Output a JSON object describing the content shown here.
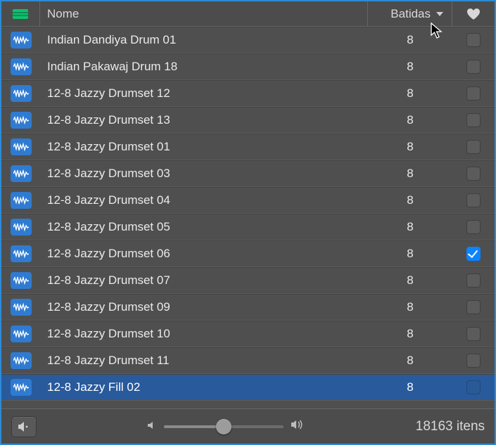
{
  "header": {
    "name_label": "Nome",
    "beats_label": "Batidas",
    "sort_direction": "desc"
  },
  "rows": [
    {
      "name": "Indian Dandiya Drum 01",
      "beats": "8",
      "favorite": false,
      "selected": false
    },
    {
      "name": "Indian Pakawaj Drum 18",
      "beats": "8",
      "favorite": false,
      "selected": false
    },
    {
      "name": "12-8 Jazzy Drumset 12",
      "beats": "8",
      "favorite": false,
      "selected": false
    },
    {
      "name": "12-8 Jazzy Drumset 13",
      "beats": "8",
      "favorite": false,
      "selected": false
    },
    {
      "name": "12-8 Jazzy Drumset 01",
      "beats": "8",
      "favorite": false,
      "selected": false
    },
    {
      "name": "12-8 Jazzy Drumset 03",
      "beats": "8",
      "favorite": false,
      "selected": false
    },
    {
      "name": "12-8 Jazzy Drumset 04",
      "beats": "8",
      "favorite": false,
      "selected": false
    },
    {
      "name": "12-8 Jazzy Drumset 05",
      "beats": "8",
      "favorite": false,
      "selected": false
    },
    {
      "name": "12-8 Jazzy Drumset 06",
      "beats": "8",
      "favorite": true,
      "selected": false
    },
    {
      "name": "12-8 Jazzy Drumset 07",
      "beats": "8",
      "favorite": false,
      "selected": false
    },
    {
      "name": "12-8 Jazzy Drumset 09",
      "beats": "8",
      "favorite": false,
      "selected": false
    },
    {
      "name": "12-8 Jazzy Drumset 10",
      "beats": "8",
      "favorite": false,
      "selected": false
    },
    {
      "name": "12-8 Jazzy Drumset 11",
      "beats": "8",
      "favorite": false,
      "selected": false
    },
    {
      "name": "12-8 Jazzy Fill 02",
      "beats": "8",
      "favorite": false,
      "selected": true
    }
  ],
  "footer": {
    "volume_percent": 50,
    "item_count": "18163",
    "item_word": "itens"
  },
  "icons": {
    "loop": "audio-loop-icon",
    "heart": "heart-icon",
    "chevron": "chevron-down-icon",
    "speaker": "speaker-icon",
    "vol_low": "volume-low-icon",
    "vol_high": "volume-high-icon",
    "view": "list-view-icon"
  }
}
